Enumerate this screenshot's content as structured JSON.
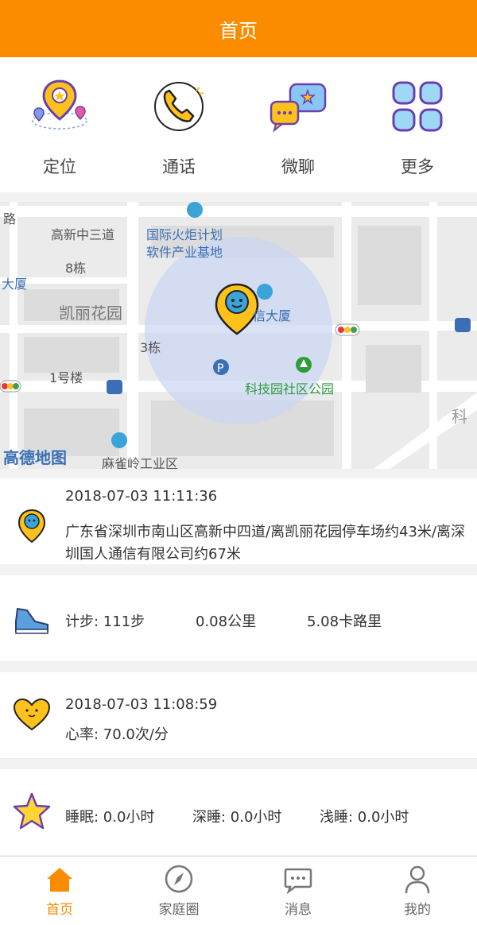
{
  "header": {
    "title": "首页"
  },
  "quick": [
    {
      "label": "定位",
      "icon": "location-pin-icon"
    },
    {
      "label": "通话",
      "icon": "phone-icon"
    },
    {
      "label": "微聊",
      "icon": "chat-bubbles-icon"
    },
    {
      "label": "更多",
      "icon": "grid-more-icon"
    }
  ],
  "map": {
    "labels": [
      "路",
      "高新中三道",
      "国际火炬计划",
      "软件产业基地",
      "8栋",
      "大厦",
      "凯丽花园",
      "信大厦",
      "3栋",
      "1号楼",
      "科技园社区公园",
      "高德地图",
      "麻雀岭工业区",
      "科"
    ]
  },
  "location_card": {
    "time": "2018-07-03 11:11:36",
    "address": "广东省深圳市南山区高新中四道/离凯丽花园停车场约43米/离深圳国人通信有限公司约67米"
  },
  "steps_card": {
    "steps": "计步: 111步",
    "distance": "0.08公里",
    "calories": "5.08卡路里"
  },
  "heart_card": {
    "time": "2018-07-03 11:08:59",
    "rate": "心率: 70.0次/分"
  },
  "sleep_card": {
    "sleep": "睡眠: 0.0小时",
    "deep": "深睡: 0.0小时",
    "light": "浅睡: 0.0小时"
  },
  "tabs": [
    {
      "label": "首页",
      "icon": "home-icon"
    },
    {
      "label": "家庭圈",
      "icon": "compass-icon"
    },
    {
      "label": "消息",
      "icon": "message-icon"
    },
    {
      "label": "我的",
      "icon": "user-icon"
    }
  ],
  "colors": {
    "accent": "#fb8c00",
    "map_circle": "#c9d6f2",
    "park_green": "#2e9c3a",
    "map_label_blue": "#3b6fb5"
  }
}
